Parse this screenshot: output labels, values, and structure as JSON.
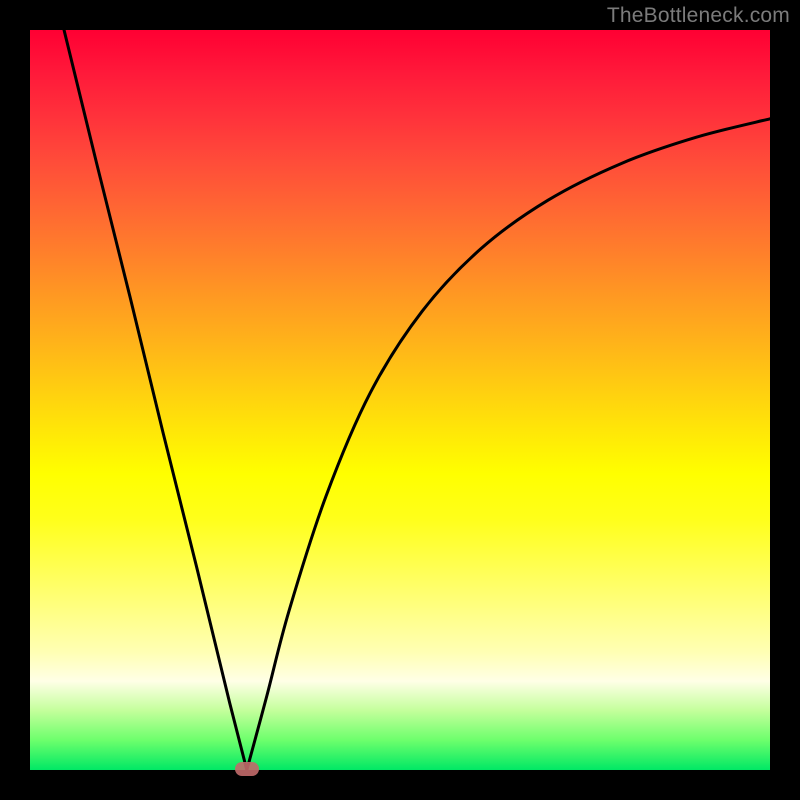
{
  "watermark": "TheBottleneck.com",
  "chart_data": {
    "type": "line",
    "title": "",
    "xlabel": "",
    "ylabel": "",
    "xlim": [
      0,
      1
    ],
    "ylim": [
      0,
      1
    ],
    "grid": false,
    "legend": false,
    "min_marker": {
      "x": 0.293,
      "y": 0.0
    },
    "series": [
      {
        "name": "left-branch",
        "x": [
          0.046,
          0.09,
          0.135,
          0.18,
          0.225,
          0.27,
          0.293
        ],
        "y": [
          1.0,
          0.82,
          0.64,
          0.455,
          0.275,
          0.09,
          0.0
        ]
      },
      {
        "name": "right-branch",
        "x": [
          0.293,
          0.32,
          0.35,
          0.4,
          0.46,
          0.53,
          0.61,
          0.7,
          0.8,
          0.9,
          1.0
        ],
        "y": [
          0.0,
          0.1,
          0.215,
          0.37,
          0.51,
          0.62,
          0.705,
          0.77,
          0.82,
          0.855,
          0.88
        ]
      }
    ]
  },
  "colors": {
    "curve": "#000000",
    "frame": "#000000",
    "pill": "#c26a6a"
  }
}
